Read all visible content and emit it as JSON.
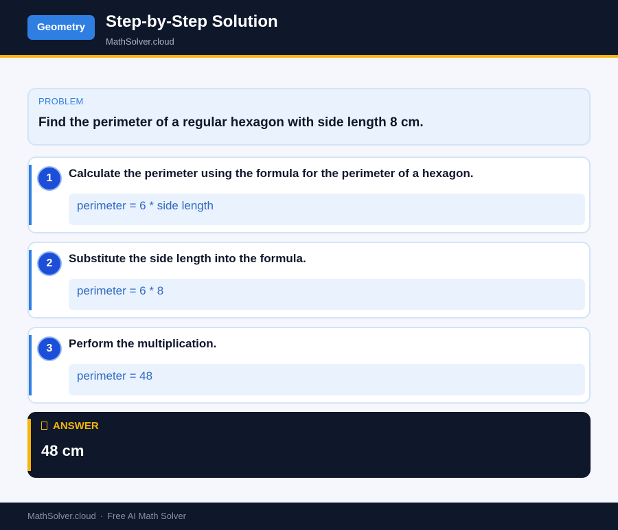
{
  "header": {
    "badge": "Geometry",
    "title": "Step-by-Step Solution",
    "subtitle": "MathSolver.cloud"
  },
  "problem": {
    "label": "PROBLEM",
    "text": "Find the perimeter of a regular hexagon with side length 8 cm."
  },
  "steps": [
    {
      "number": "1",
      "title": "Calculate the perimeter using the formula for the perimeter of a hexagon.",
      "formula": "perimeter = 6 * side length"
    },
    {
      "number": "2",
      "title": "Substitute the side length into the formula.",
      "formula": "perimeter = 6 * 8"
    },
    {
      "number": "3",
      "title": "Perform the multiplication.",
      "formula": "perimeter = 48"
    }
  ],
  "answer": {
    "icon": "answer-icon",
    "label": "ANSWER",
    "value": "48 cm"
  },
  "footer": {
    "site": "MathSolver.cloud",
    "separator": "·",
    "tagline": "Free AI Math Solver"
  },
  "colors": {
    "header_bg": "#0f172a",
    "accent_blue": "#2f7fe3",
    "accent_gold": "#f5b50a"
  }
}
